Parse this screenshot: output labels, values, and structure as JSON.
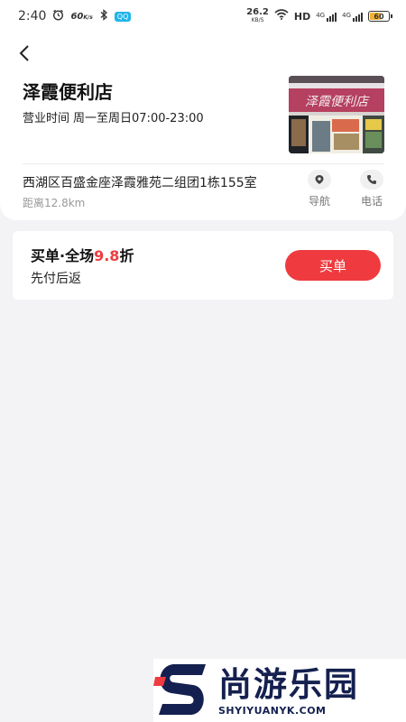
{
  "status_bar": {
    "time": "2:40",
    "speed_left": "60",
    "speed_left_unit": "K/s",
    "app_badge": "QQ",
    "net_speed_value": "26.2",
    "net_speed_unit": "KB/S",
    "hd_label": "HD",
    "sim1_label": "4G",
    "sim2_label": "4G",
    "battery_level": "60"
  },
  "store": {
    "name": "泽霞便利店",
    "hours_label": "营业时间",
    "hours_value": "周一至周日07:00-23:00",
    "photo_sign_text": "泽霞便利店",
    "address": "西湖区百盛金座泽霞雅苑二组团1栋155室",
    "distance": "距离12.8km",
    "nav_label": "导航",
    "phone_label": "电话"
  },
  "promo": {
    "title_prefix": "买单·全场",
    "title_rate": "9.8",
    "title_suffix": "折",
    "subtitle": "先付后返",
    "pay_button": "买单"
  },
  "watermark": {
    "cn": "尚游乐园",
    "en": "SHYIYUANYK.COM"
  },
  "colors": {
    "accent": "#ef3b3f",
    "background": "#f3f3f5",
    "watermark": "#14204f"
  },
  "icons": [
    "back-arrow-icon",
    "location-pin-icon",
    "phone-icon",
    "alarm-icon",
    "bluetooth-icon",
    "wifi-icon",
    "signal-icon",
    "battery-icon"
  ]
}
